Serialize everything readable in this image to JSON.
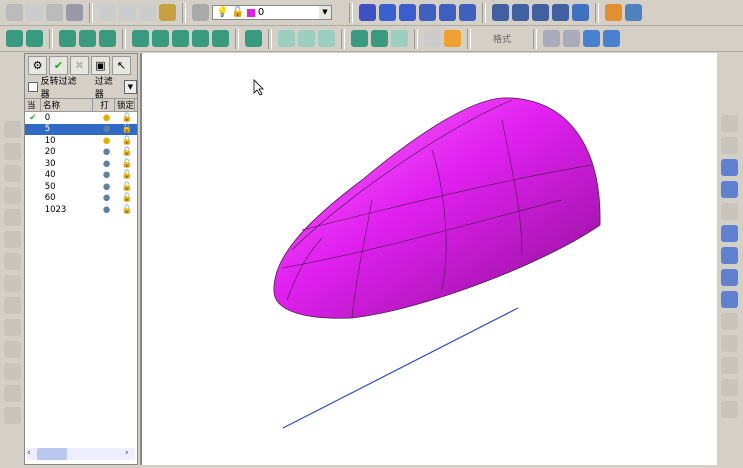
{
  "toolbar": {
    "layer_value": "0",
    "format_label": "格式",
    "layer_color": "#e020e0"
  },
  "panel": {
    "reverse_filter_label": "反转过滤器",
    "filter_label": "过滤器",
    "columns": [
      "当",
      "名称",
      "打",
      "锁定"
    ],
    "layers": [
      {
        "name": "0",
        "current": true,
        "on": true
      },
      {
        "name": "5",
        "selected": true
      },
      {
        "name": "10",
        "on": true
      },
      {
        "name": "20"
      },
      {
        "name": "30"
      },
      {
        "name": "40"
      },
      {
        "name": "50"
      },
      {
        "name": "60"
      },
      {
        "name": "1023"
      }
    ]
  },
  "colors": {
    "surface": "#e020f0",
    "line": "#3050c0",
    "selection": "#316ac5"
  }
}
